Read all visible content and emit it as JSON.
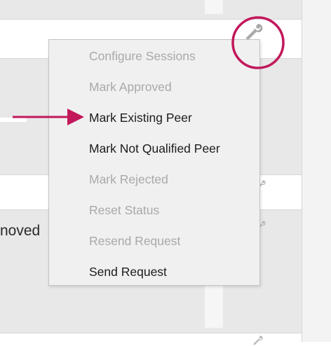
{
  "rows": [
    {
      "style": "gray"
    },
    {
      "style": "white"
    },
    {
      "style": "gray"
    },
    {
      "style": "white"
    },
    {
      "style": "gray"
    },
    {
      "style": "white"
    }
  ],
  "visible_row_text": "noved",
  "menu": {
    "items": [
      {
        "label": "Configure Sessions",
        "enabled": false
      },
      {
        "label": "Mark Approved",
        "enabled": false
      },
      {
        "label": "Mark Existing Peer",
        "enabled": true
      },
      {
        "label": "Mark Not Qualified Peer",
        "enabled": true
      },
      {
        "label": "Mark Rejected",
        "enabled": false
      },
      {
        "label": "Reset Status",
        "enabled": false
      },
      {
        "label": "Resend Request",
        "enabled": false
      },
      {
        "label": "Send Request",
        "enabled": true
      }
    ]
  },
  "icons": {
    "actions": "wrench-icon",
    "annotation_arrow": "arrow-right-icon",
    "annotation_circle": "highlight-circle"
  },
  "colors": {
    "annotation": "#c2185b",
    "disabled_text": "#a9a9a9",
    "enabled_text": "#1c1c1c",
    "menu_background": "#f0f0f0",
    "row_gray": "#e8e8e8"
  }
}
